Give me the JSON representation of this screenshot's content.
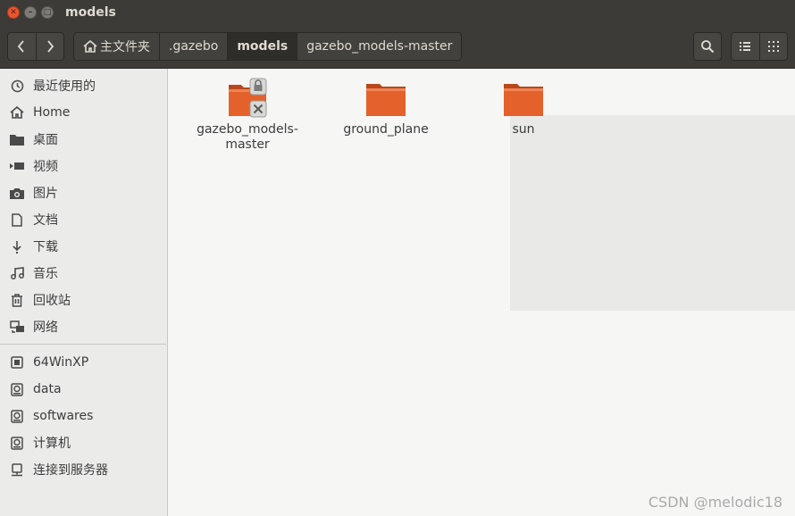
{
  "window": {
    "title": "models"
  },
  "toolbar": {
    "breadcrumbs": [
      {
        "label": "主文件夹"
      },
      {
        "label": ".gazebo"
      },
      {
        "label": "models"
      },
      {
        "label": "gazebo_models-master"
      }
    ]
  },
  "sidebar": {
    "places": [
      {
        "label": "最近使用的",
        "icon": "recent-icon"
      },
      {
        "label": "Home",
        "icon": "home-icon"
      },
      {
        "label": "桌面",
        "icon": "desktop-folder-icon"
      },
      {
        "label": "视频",
        "icon": "video-icon"
      },
      {
        "label": "图片",
        "icon": "camera-icon"
      },
      {
        "label": "文档",
        "icon": "document-icon"
      },
      {
        "label": "下载",
        "icon": "download-icon"
      },
      {
        "label": "音乐",
        "icon": "music-icon"
      },
      {
        "label": "回收站",
        "icon": "trash-icon"
      },
      {
        "label": "网络",
        "icon": "network-icon"
      }
    ],
    "devices": [
      {
        "label": "64WinXP",
        "icon": "chip-icon"
      },
      {
        "label": "data",
        "icon": "drive-icon"
      },
      {
        "label": "softwares",
        "icon": "drive-icon"
      },
      {
        "label": "计算机",
        "icon": "drive-icon"
      },
      {
        "label": "连接到服务器",
        "icon": "server-icon"
      }
    ]
  },
  "files": [
    {
      "name": "gazebo_models-\nmaster",
      "icon": "folder-locked-icon"
    },
    {
      "name": "ground_plane",
      "icon": "folder-icon"
    },
    {
      "name": "sun",
      "icon": "folder-icon"
    }
  ],
  "watermark": "CSDN @melodic18",
  "colors": {
    "folder": "#e5612b",
    "titlebar": "#3c3b37",
    "close": "#e9562e"
  }
}
